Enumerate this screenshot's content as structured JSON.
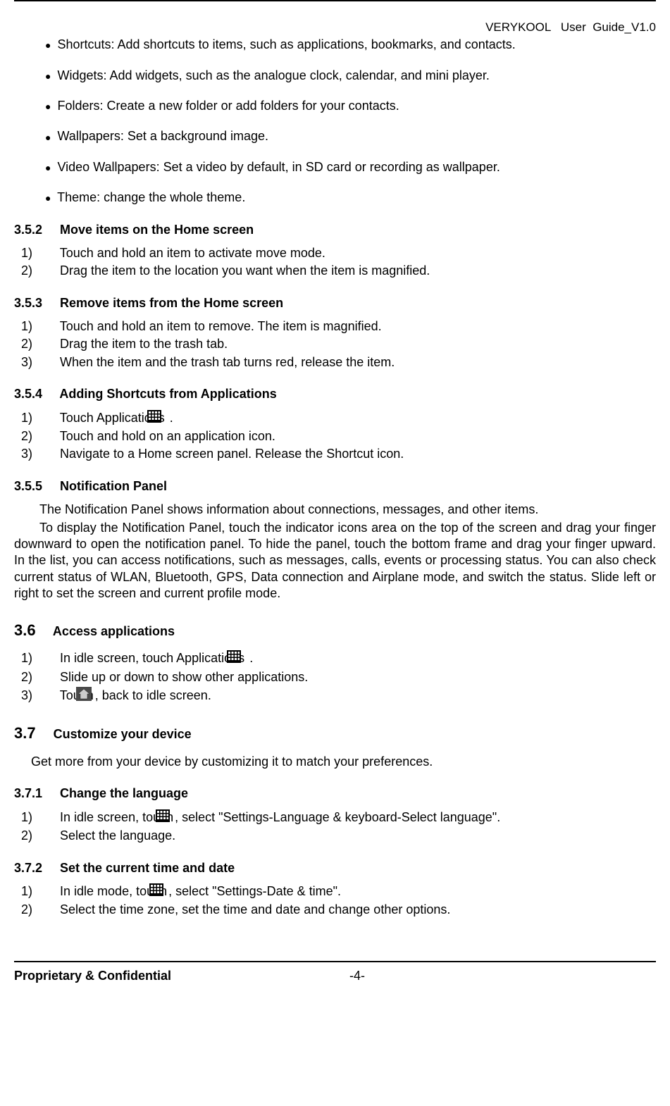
{
  "header": {
    "title": "VERYKOOL   User  Guide_V1.0"
  },
  "bullets": [
    {
      "label": "Shortcuts: Add shortcuts to items, such as applications, bookmarks, and contacts."
    },
    {
      "label": "Widgets: Add widgets, such as the analogue clock, calendar, and mini player."
    },
    {
      "label": "Folders: Create a new folder or add folders for your contacts."
    },
    {
      "label": "Wallpapers: Set a background image."
    },
    {
      "label": "Video Wallpapers: Set a video by default, in SD card or recording as wallpaper."
    },
    {
      "label": "Theme: change the whole theme."
    }
  ],
  "s352": {
    "heading": "3.5.2     Move items on the Home screen",
    "items": [
      {
        "num": "1)",
        "text": "Touch and hold an item to activate move mode."
      },
      {
        "num": "2)",
        "text": "Drag the item to the location you want when the item is magnified."
      }
    ]
  },
  "s353": {
    "heading": "3.5.3     Remove items from the Home screen",
    "items": [
      {
        "num": "1)",
        "text": "Touch and hold an item to remove. The item is magnified."
      },
      {
        "num": "2)",
        "text": "Drag the item to the trash tab."
      },
      {
        "num": "3)",
        "text": "When the item and the trash tab turns red, release the item."
      }
    ]
  },
  "s354": {
    "heading": "3.5.4     Adding Shortcuts from Applications",
    "items": [
      {
        "num": "1)",
        "pre": "Touch Applications",
        "post": " ."
      },
      {
        "num": "2)",
        "text": "Touch and hold on an application icon."
      },
      {
        "num": "3)",
        "text": "Navigate to a Home screen panel. Release the Shortcut icon."
      }
    ]
  },
  "s355": {
    "heading": "3.5.5     Notification Panel",
    "p1": "The Notification Panel shows information about connections, messages, and other items.",
    "p2": "To display the Notification Panel, touch the indicator icons area on the top of the screen and drag your finger downward to open the notification panel. To hide the panel, touch the bottom frame and drag your finger upward. In the list, you can access notifications, such as messages, calls, events or processing status. You can also check current status of WLAN, Bluetooth, GPS, Data connection and Airplane mode, and switch the status. Slide left or right to set the screen and current profile mode."
  },
  "s36": {
    "num": "3.6",
    "title": "     Access applications",
    "items": [
      {
        "num": "1)",
        "pre": "In idle screen, touch Applications",
        "post": " ."
      },
      {
        "num": "2)",
        "text": "Slide up or down to show other applications."
      },
      {
        "num": "3)",
        "pre": "Touch",
        "post": ", back to idle screen."
      }
    ]
  },
  "s37": {
    "num": "3.7",
    "title": "     Customize your device",
    "desc": "Get more from your device by customizing it to match your preferences."
  },
  "s371": {
    "heading": "3.7.1     Change the language",
    "items": [
      {
        "num": "1)",
        "pre": "In idle screen, touch",
        "post": ", select \"Settings-Language & keyboard-Select language\"."
      },
      {
        "num": "2)",
        "text": "Select the language."
      }
    ]
  },
  "s372": {
    "heading": "3.7.2     Set the current time and date",
    "items": [
      {
        "num": "1)",
        "pre": "In idle mode, touch",
        "post": ", select \"Settings-Date & time\"."
      },
      {
        "num": "2)",
        "text": "Select the time zone, set the time and date and change other options."
      }
    ]
  },
  "footer": {
    "left": "Proprietary & Confidential",
    "page": "-4-"
  },
  "icons": {
    "grid": "applications-grid-icon",
    "home": "home-icon"
  }
}
